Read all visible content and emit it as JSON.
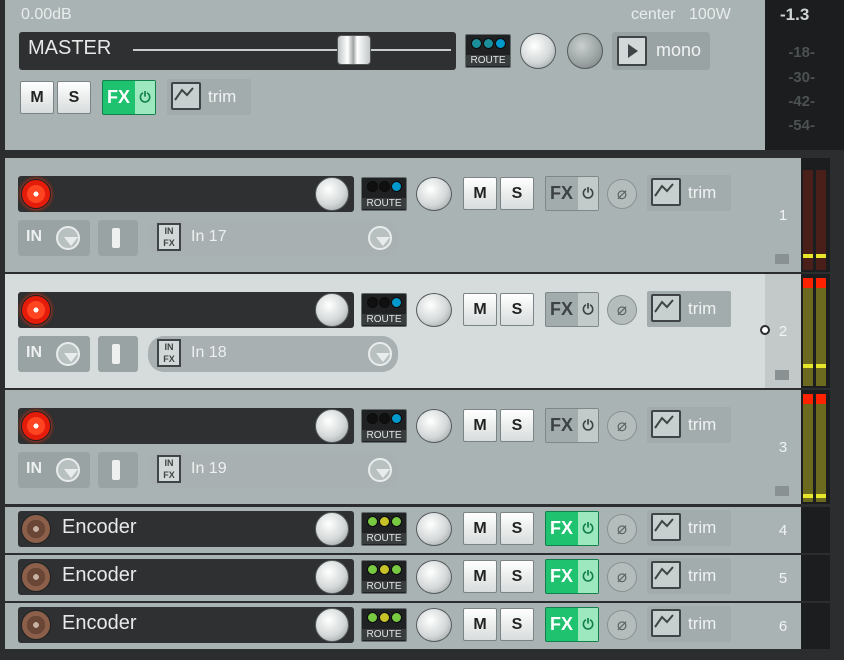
{
  "master": {
    "volume": "0.00dB",
    "pan": "center",
    "width": "100W",
    "name": "MASTER",
    "route_label": "ROUTE",
    "mono_label": "mono",
    "mute_label": "M",
    "solo_label": "S",
    "fx_label": "FX",
    "trim_label": "trim",
    "meter": {
      "peak": "-1.3",
      "ticks": [
        "-18-",
        "-30-",
        "-42-",
        "-54-"
      ]
    }
  },
  "tracks": [
    {
      "number": "1",
      "name": "",
      "armed": true,
      "input_label": "IN",
      "input": "In 17",
      "route_label": "ROUTE",
      "mute_label": "M",
      "solo_label": "S",
      "fx_label": "FX",
      "fx_active": false,
      "trim_label": "trim",
      "selected": false
    },
    {
      "number": "2",
      "name": "",
      "armed": true,
      "input_label": "IN",
      "input": "In 18",
      "route_label": "ROUTE",
      "mute_label": "M",
      "solo_label": "S",
      "fx_label": "FX",
      "fx_active": false,
      "trim_label": "trim",
      "selected": true
    },
    {
      "number": "3",
      "name": "",
      "armed": true,
      "input_label": "IN",
      "input": "In 19",
      "route_label": "ROUTE",
      "mute_label": "M",
      "solo_label": "S",
      "fx_label": "FX",
      "fx_active": false,
      "trim_label": "trim",
      "selected": false
    },
    {
      "number": "4",
      "name": "Encoder",
      "armed": false,
      "route_label": "ROUTE",
      "mute_label": "M",
      "solo_label": "S",
      "fx_label": "FX",
      "fx_active": true,
      "trim_label": "trim",
      "selected": false
    },
    {
      "number": "5",
      "name": "Encoder",
      "armed": false,
      "route_label": "ROUTE",
      "mute_label": "M",
      "solo_label": "S",
      "fx_label": "FX",
      "fx_active": true,
      "trim_label": "trim",
      "selected": false
    },
    {
      "number": "6",
      "name": "Encoder",
      "armed": false,
      "route_label": "ROUTE",
      "mute_label": "M",
      "solo_label": "S",
      "fx_label": "FX",
      "fx_active": true,
      "trim_label": "trim",
      "selected": false
    }
  ],
  "io_icon_label": "IN FX",
  "colors": {
    "fx_active": "#1ec26f",
    "rec_armed": "#e51c0a",
    "route_dot_on": "#0099cc",
    "route_dot_green": "#7ac943",
    "meter_peak": "#ff2200",
    "meter_level": "#e6e62a"
  }
}
